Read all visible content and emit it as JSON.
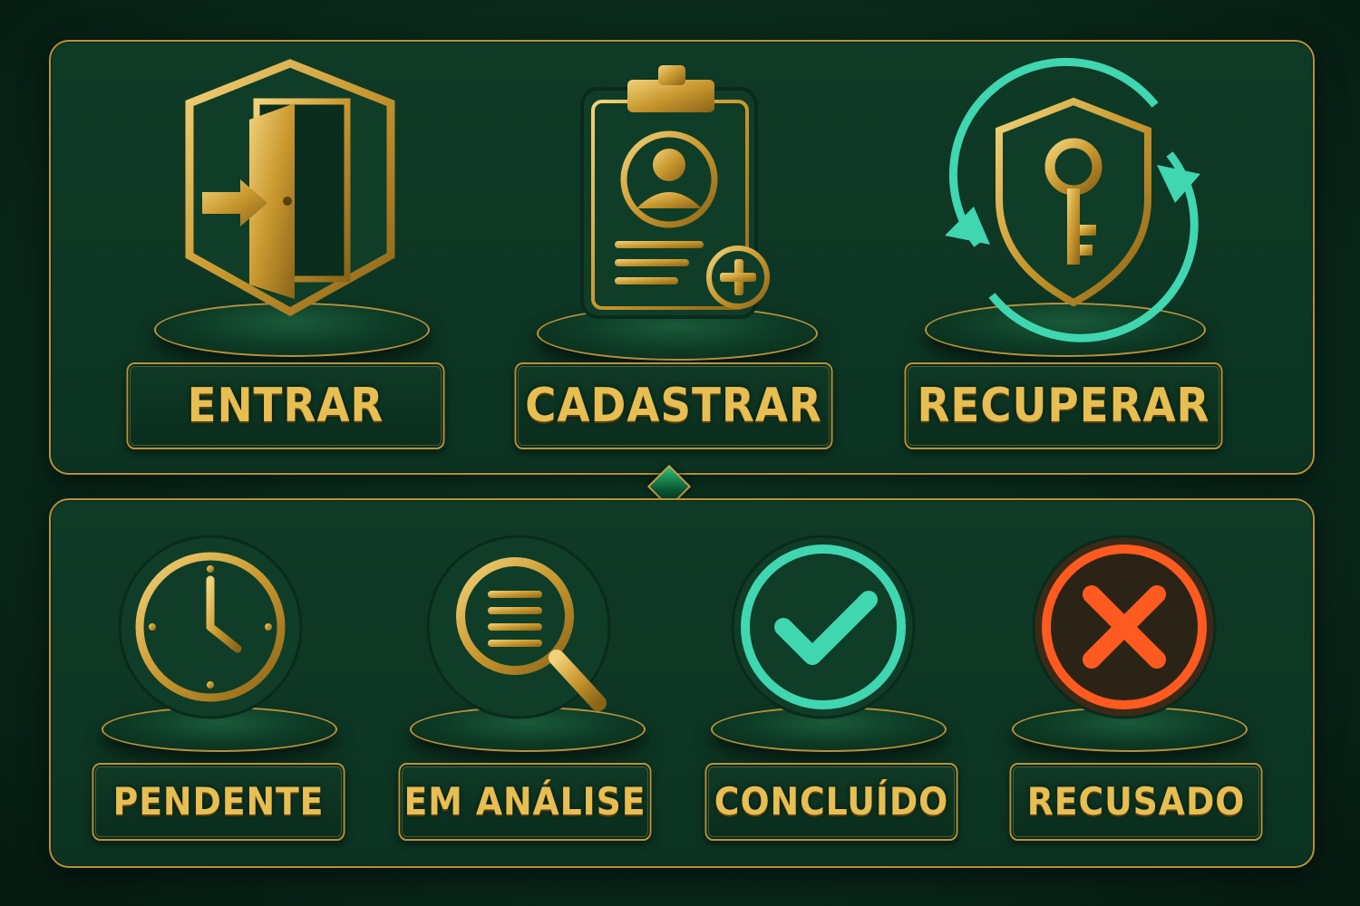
{
  "actions": [
    {
      "label": "ENTRAR",
      "icon": "door-enter-icon"
    },
    {
      "label": "CADASTRAR",
      "icon": "clipboard-add-user-icon"
    },
    {
      "label": "RECUPERAR",
      "icon": "shield-key-recover-icon"
    }
  ],
  "statuses": [
    {
      "label": "PENDENTE",
      "icon": "clock-icon",
      "color": "#d4aa45"
    },
    {
      "label": "EM ANÁLISE",
      "icon": "magnifier-list-icon",
      "color": "#d4aa45"
    },
    {
      "label": "CONCLUÍDO",
      "icon": "check-circle-icon",
      "color": "#3fd6b0"
    },
    {
      "label": "RECUSADO",
      "icon": "x-circle-icon",
      "color": "#ff5a1f"
    }
  ],
  "colors": {
    "gold": "#d4aa45",
    "teal": "#3fd6b0",
    "red": "#ff5a1f",
    "panel": "#0f3a26"
  }
}
